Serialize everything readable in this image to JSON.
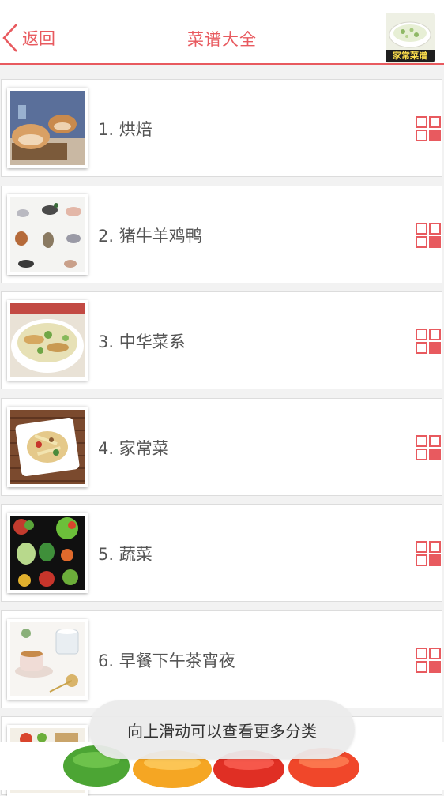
{
  "header": {
    "back_label": "返回",
    "title": "菜谱大全",
    "logo_text": "家常菜谱"
  },
  "categories": [
    {
      "label": "1. 烘焙",
      "image": "bread"
    },
    {
      "label": "2. 猪牛羊鸡鸭",
      "image": "poultry-and-livestock"
    },
    {
      "label": "3. 中华菜系",
      "image": "chinese-soup"
    },
    {
      "label": "4. 家常菜",
      "image": "home-stir-fry"
    },
    {
      "label": "5. 蔬菜",
      "image": "vegetables"
    },
    {
      "label": "6. 早餐下午茶宵夜",
      "image": "coffee-and-tea"
    }
  ],
  "toast": {
    "text": "向上滑动可以查看更多分类"
  },
  "colors": {
    "accent": "#e85a5f",
    "label_text": "#555555",
    "background": "#f2f2f2"
  }
}
